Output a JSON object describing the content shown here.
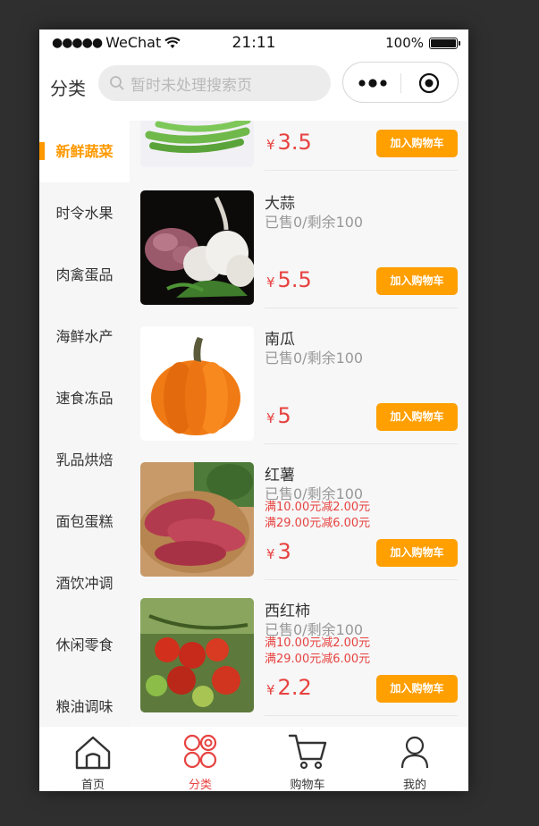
{
  "status_bar": {
    "signal": "●●●●●",
    "carrier": "WeChat",
    "time": "21:11",
    "battery": "100%"
  },
  "header": {
    "title": "分类",
    "search_placeholder": "暂时未处理搜索页"
  },
  "sidebar": {
    "items": [
      {
        "label": "新鲜蔬菜",
        "active": true
      },
      {
        "label": "时令水果"
      },
      {
        "label": "肉禽蛋品"
      },
      {
        "label": "海鲜水产"
      },
      {
        "label": "速食冻品"
      },
      {
        "label": "乳品烘焙"
      },
      {
        "label": "面包蛋糕"
      },
      {
        "label": "酒饮冲调"
      },
      {
        "label": "休闲零食"
      },
      {
        "label": "粮油调味"
      }
    ]
  },
  "products": [
    {
      "name": "",
      "sold": "",
      "price": "3.5",
      "currency": "¥",
      "cart_label": "加入购物车",
      "image": "green-beans"
    },
    {
      "name": "大蒜",
      "sold": "已售0/剩余100",
      "price": "5.5",
      "currency": "¥",
      "cart_label": "加入购物车",
      "image": "garlic"
    },
    {
      "name": "南瓜",
      "sold": "已售0/剩余100",
      "price": "5",
      "currency": "¥",
      "cart_label": "加入购物车",
      "image": "pumpkin"
    },
    {
      "name": "红薯",
      "sold": "已售0/剩余100",
      "promos": [
        "满10.00元减2.00元",
        "满29.00元减6.00元"
      ],
      "price": "3",
      "currency": "¥",
      "cart_label": "加入购物车",
      "image": "sweet-potato"
    },
    {
      "name": "西红柿",
      "sold": "已售0/剩余100",
      "promos": [
        "满10.00元减2.00元",
        "满29.00元减6.00元"
      ],
      "price": "2.2",
      "currency": "¥",
      "cart_label": "加入购物车",
      "image": "tomato"
    }
  ],
  "tabbar": {
    "items": [
      {
        "label": "首页",
        "icon": "home-icon"
      },
      {
        "label": "分类",
        "icon": "category-icon",
        "active": true
      },
      {
        "label": "购物车",
        "icon": "cart-icon"
      },
      {
        "label": "我的",
        "icon": "profile-icon"
      }
    ]
  },
  "colors": {
    "accent": "#ff9900",
    "price": "#e64340",
    "cart_button": "#ff9f00"
  }
}
